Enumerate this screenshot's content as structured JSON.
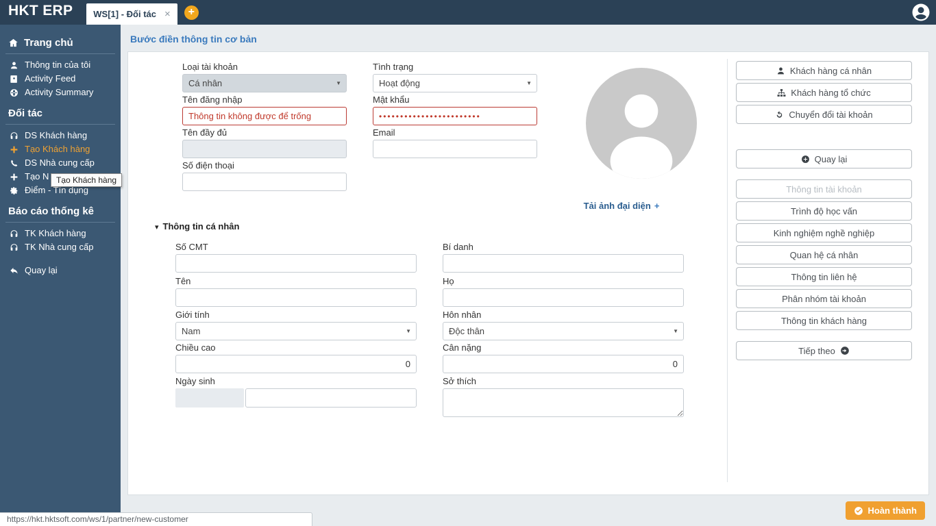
{
  "colors": {
    "topbar": "#2b4156",
    "sidebar": "#3b5873",
    "accent_orange": "#f0a030",
    "add_tab_yellow": "#f2a71d",
    "title_blue": "#3a7abd",
    "error_red": "#c0392b"
  },
  "topbar": {
    "brand": "HKT ERP",
    "tab": {
      "label": "WS[1] - Đối tác",
      "close": "×"
    },
    "add_tab": "+",
    "avatar_icon": "account"
  },
  "sidebar": {
    "sections": [
      {
        "header": "Trang chủ",
        "icon": "home",
        "items": [
          {
            "label": "Thông tin của tôi",
            "icon": "user"
          },
          {
            "label": "Activity Feed",
            "icon": "address-book"
          },
          {
            "label": "Activity Summary",
            "icon": "globe"
          }
        ]
      },
      {
        "header": "Đối tác",
        "items": [
          {
            "label": "DS Khách hàng",
            "icon": "headset"
          },
          {
            "label": "Tạo Khách hàng",
            "icon": "plus",
            "active": true
          },
          {
            "label": "DS Nhà cung cấp",
            "icon": "phone"
          },
          {
            "label": "Tạo N",
            "icon": "plus"
          },
          {
            "label": "Điểm - Tín dụng",
            "icon": "gear"
          }
        ]
      },
      {
        "header": "Báo cáo thống kê",
        "items": [
          {
            "label": "TK Khách hàng",
            "icon": "headset"
          },
          {
            "label": "TK Nhà cung cấp",
            "icon": "headset"
          }
        ]
      }
    ],
    "back_item": {
      "label": "Quay lại",
      "icon": "reply"
    },
    "tooltip": "Tạo Khách hàng"
  },
  "main": {
    "title": "Bước điền thông tin cơ bản",
    "form": {
      "account_type": {
        "label": "Loại tài khoản",
        "value": "Cá nhân"
      },
      "status": {
        "label": "Tình trạng",
        "value": "Hoạt động"
      },
      "username": {
        "label": "Tên đăng nhập",
        "value": "",
        "placeholder": "Thông tin không được để trống"
      },
      "password": {
        "label": "Mật khẩu",
        "value": "••••••••••••••••••••••••"
      },
      "fullname": {
        "label": "Tên đầy đủ",
        "value": ""
      },
      "email": {
        "label": "Email",
        "value": ""
      },
      "phone": {
        "label": "Số điện thoại",
        "value": ""
      },
      "upload_avatar": {
        "label": "Tải ảnh đại diện",
        "plus": "+"
      }
    },
    "personal": {
      "header": "Thông tin cá nhân",
      "id_number": {
        "label": "Số CMT",
        "value": ""
      },
      "nickname": {
        "label": "Bí danh",
        "value": ""
      },
      "first_name": {
        "label": "Tên",
        "value": ""
      },
      "last_name": {
        "label": "Họ",
        "value": ""
      },
      "gender": {
        "label": "Giới tính",
        "value": "Nam"
      },
      "marital": {
        "label": "Hôn nhân",
        "value": "Độc thân"
      },
      "height": {
        "label": "Chiều cao",
        "value": "0"
      },
      "weight": {
        "label": "Cân nặng",
        "value": "0"
      },
      "dob": {
        "label": "Ngày sinh",
        "value": ""
      },
      "hobby": {
        "label": "Sở thích",
        "value": ""
      }
    }
  },
  "right_panel": {
    "top_buttons": [
      {
        "label": "Khách hàng cá nhân",
        "icon": "user"
      },
      {
        "label": "Khách hàng tổ chức",
        "icon": "sitemap"
      },
      {
        "label": "Chuyển đổi tài khoản",
        "icon": "refresh"
      }
    ],
    "back_button": {
      "label": "Quay lại",
      "icon": "plus-circle"
    },
    "nav_buttons": [
      {
        "label": "Thông tin tài khoản",
        "disabled": true
      },
      {
        "label": "Trình độ học vấn"
      },
      {
        "label": "Kinh nghiệm nghề nghiệp"
      },
      {
        "label": "Quan hệ cá nhân"
      },
      {
        "label": "Thông tin liên hệ"
      },
      {
        "label": "Phân nhóm tài khoản"
      },
      {
        "label": "Thông tin khách hàng"
      }
    ],
    "next_button": {
      "label": "Tiếp theo",
      "icon": "arrow-circle-right"
    }
  },
  "footer": {
    "finish_button": {
      "label": "Hoàn thành",
      "icon": "check-circle"
    }
  },
  "statusbar": {
    "url": "https://hkt.hktsoft.com/ws/1/partner/new-customer"
  }
}
